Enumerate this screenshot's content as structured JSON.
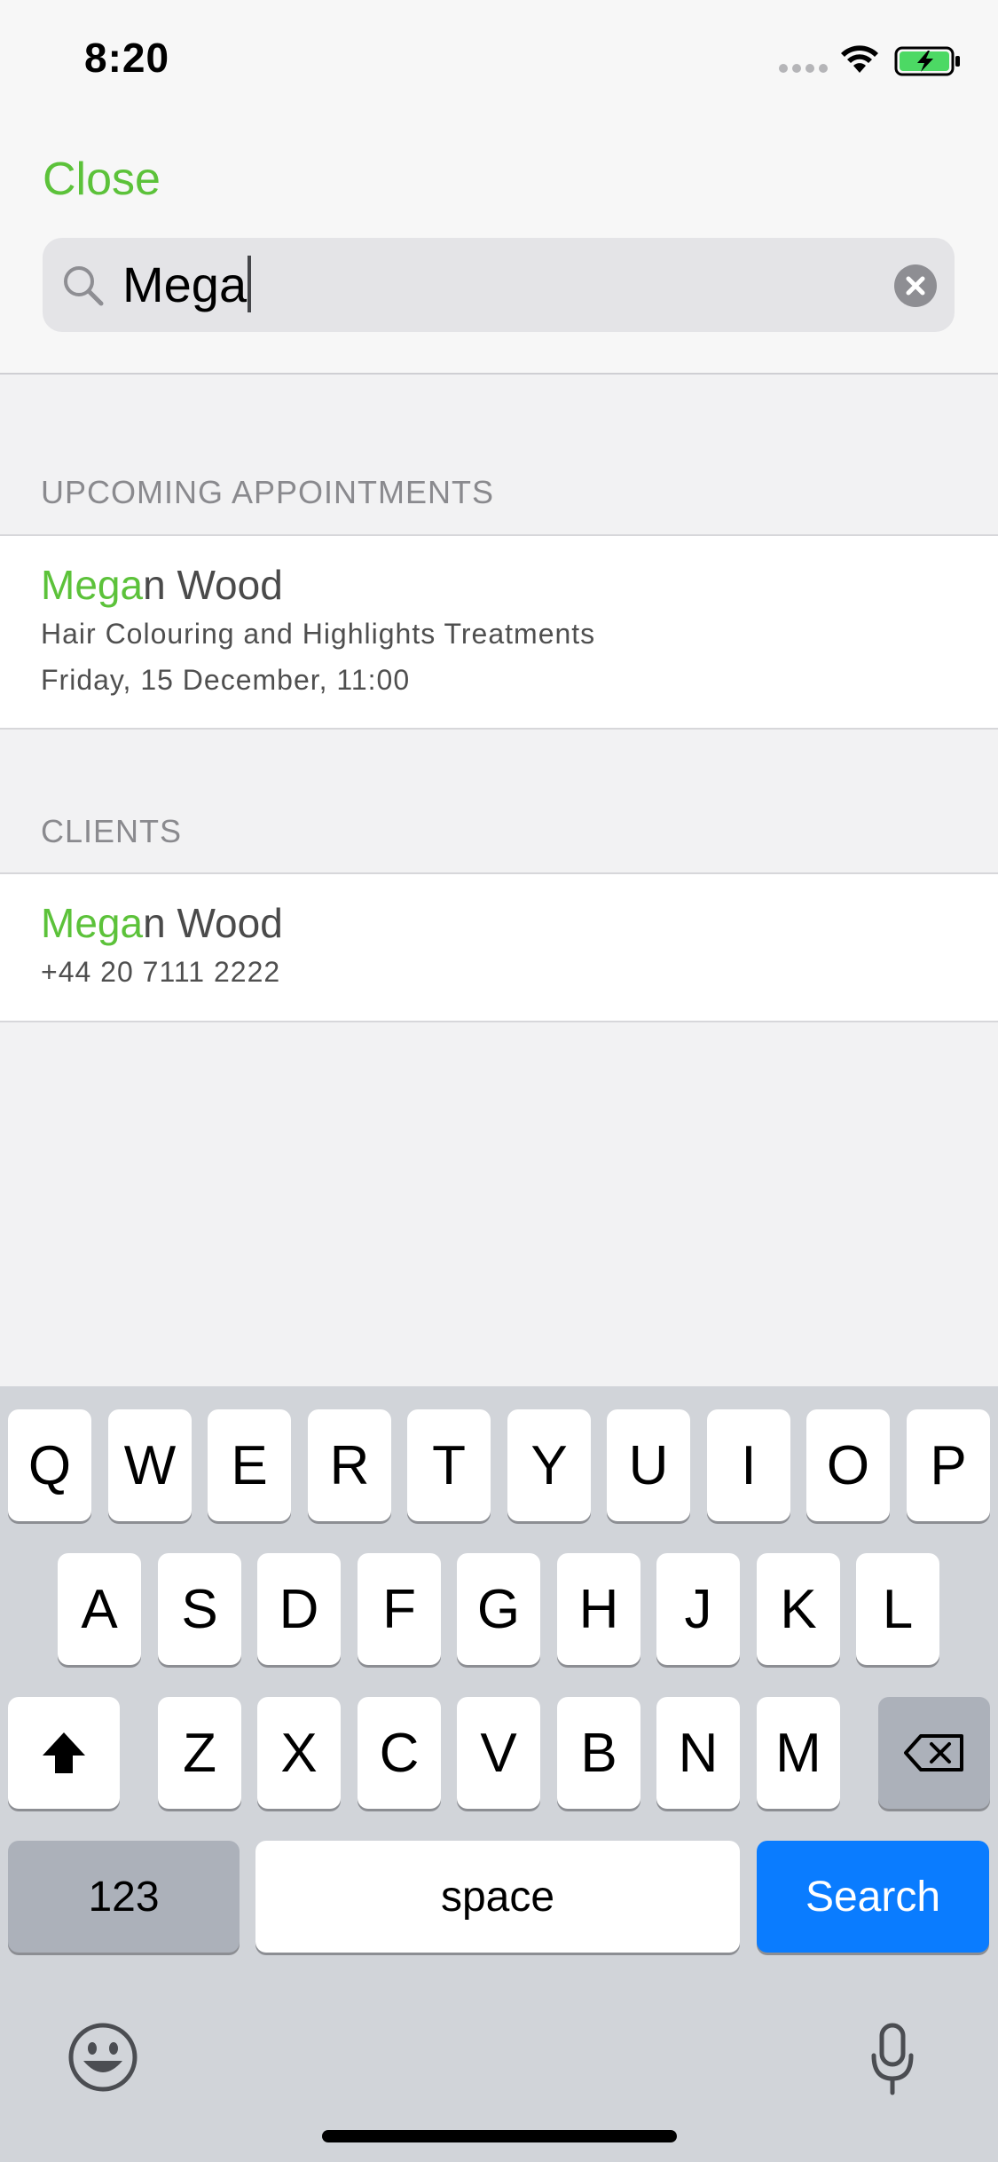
{
  "status_bar": {
    "time": "8:20"
  },
  "header": {
    "close_label": "Close",
    "search_value": "Mega"
  },
  "upcoming": {
    "section_title": "UPCOMING APPOINTMENTS",
    "items": [
      {
        "name_highlight": "Mega",
        "name_rest": "n Wood",
        "service": "Hair Colouring and Highlights Treatments",
        "datetime": "Friday, 15 December, 11:00"
      }
    ]
  },
  "clients": {
    "section_title": "CLIENTS",
    "items": [
      {
        "name_highlight": "Mega",
        "name_rest": "n Wood",
        "phone": "+44 20 7111 2222"
      }
    ]
  },
  "keyboard": {
    "row1": [
      "Q",
      "W",
      "E",
      "R",
      "T",
      "Y",
      "U",
      "I",
      "O",
      "P"
    ],
    "row2": [
      "A",
      "S",
      "D",
      "F",
      "G",
      "H",
      "J",
      "K",
      "L"
    ],
    "row3": [
      "Z",
      "X",
      "C",
      "V",
      "B",
      "N",
      "M"
    ],
    "numbers_label": "123",
    "space_label": "space",
    "action_label": "Search",
    "action_color": "#0a7cff"
  },
  "colors": {
    "accent": "#5cc23a"
  }
}
